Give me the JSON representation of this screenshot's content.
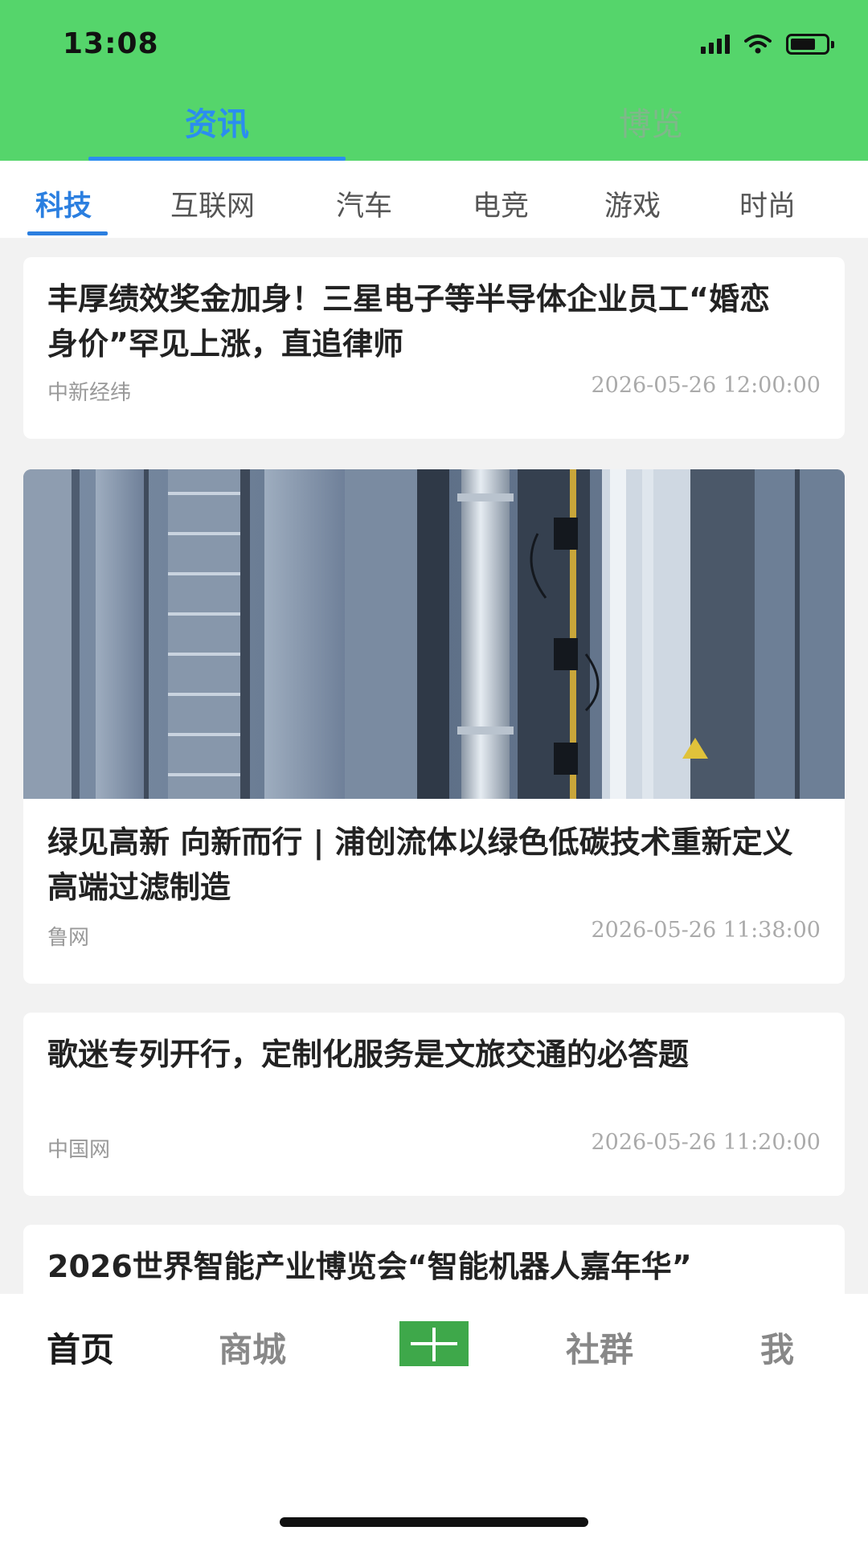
{
  "status_bar": {
    "time": "13:08"
  },
  "main_tabs": [
    {
      "label": "资讯"
    },
    {
      "label": "博览"
    }
  ],
  "categories": [
    {
      "label": "科技"
    },
    {
      "label": "互联网"
    },
    {
      "label": "汽车"
    },
    {
      "label": "电竞"
    },
    {
      "label": "游戏"
    },
    {
      "label": "时尚"
    }
  ],
  "articles": [
    {
      "title": "丰厚绩效奖金加身！三星电子等半导体企业员工“婚恋身价”罕见上涨，直追律师",
      "source": "中新经纬",
      "time": "2026-05-26 12:00:00"
    },
    {
      "title": "绿见高新 向新而行 | 浦创流体以绿色低碳技术重新定义高端过滤制造",
      "source": "鲁网",
      "time": "2026-05-26 11:38:00"
    },
    {
      "title": "歌迷专列开行，定制化服务是文旅交通的必答题",
      "source": "中国网",
      "time": "2026-05-26 11:20:00"
    },
    {
      "title": "2026世界智能产业博览会“智能机器人嘉年华”"
    }
  ],
  "bottom_nav": [
    {
      "label": "首页"
    },
    {
      "label": "商城"
    },
    {
      "label": "社群"
    },
    {
      "label": "我"
    }
  ],
  "colors": {
    "header_green": "#55d56b",
    "accent_blue": "#2b8df0",
    "add_button_green": "#3ea84a"
  }
}
